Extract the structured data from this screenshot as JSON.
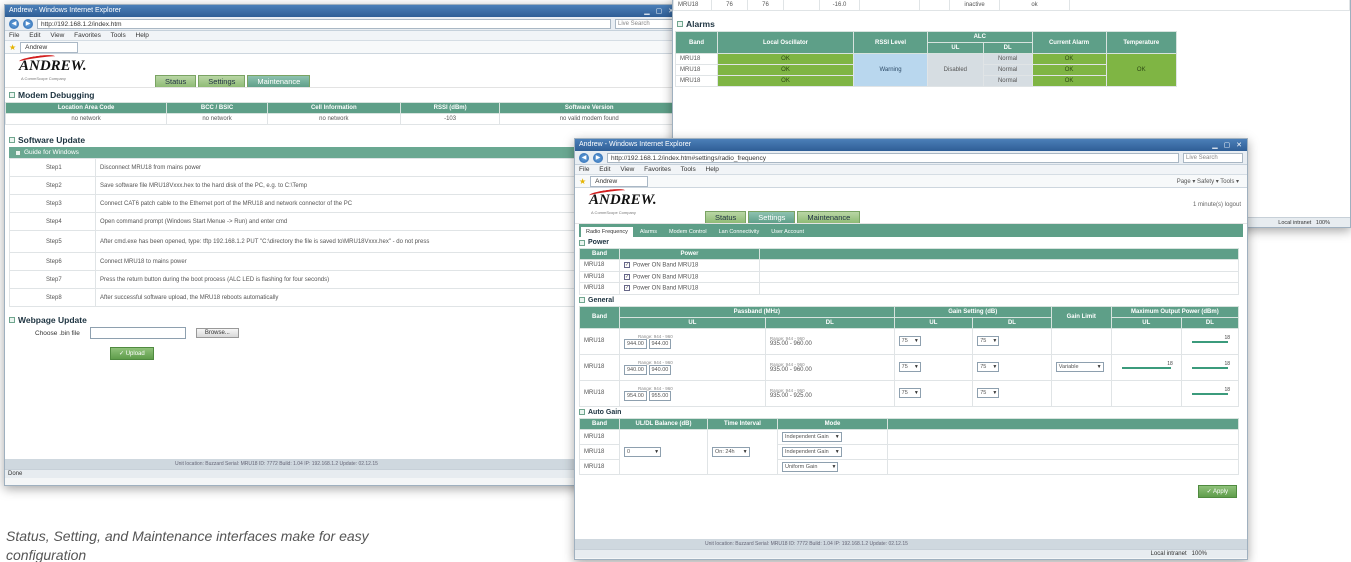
{
  "caption": "Status, Setting, and Maintenance interfaces make for easy configuration",
  "icons": [
    "back-arrow-icon",
    "forward-arrow-icon",
    "star-icon",
    "checkbox-icon",
    "dropdown-chevron-icon",
    "close-icon"
  ],
  "colors": {
    "accent_teal": "#5e9f88",
    "tab_green": "#8fbb75",
    "status_green": "#7fb544",
    "brand_red": "#d21f1f"
  },
  "win1": {
    "title": "Andrew - Windows Internet Explorer",
    "url": "http://192.168.1.2/index.htm",
    "menu": [
      "File",
      "Edit",
      "View",
      "Favorites",
      "Tools",
      "Help"
    ],
    "tab": "Andrew",
    "logo": "ANDREW.",
    "logo_sub": "A CommScope Company",
    "tabs": [
      "Status",
      "Settings",
      "Maintenance"
    ],
    "modem": {
      "title": "Modem Debugging",
      "headers": [
        "Location Area Code",
        "BCC / BSIC",
        "Cell Information",
        "RSSI (dBm)",
        "Software Version"
      ],
      "row": [
        "no network",
        "no network",
        "no network",
        "-103",
        "no valid modem found"
      ]
    },
    "software": {
      "title": "Software Update",
      "subtitle": "Guide for Windows",
      "steps": [
        {
          "step": "Step1",
          "text": "Disconnect MRU18 from mains power"
        },
        {
          "step": "Step2",
          "text": "Save software file MRU18Vxxx.hex to the hard disk of the PC, e.g. to C:\\Temp"
        },
        {
          "step": "Step3",
          "text": "Connect CAT6 patch cable to the Ethernet port of the MRU18 and network connector of the PC"
        },
        {
          "step": "Step4",
          "text": "Open command prompt (Windows Start Menue -> Run) and enter cmd"
        },
        {
          "step": "Step5",
          "text": "After cmd.exe has been opened, type: tftp 192.168.1.2 PUT \"C:\\directory the file is saved to\\MRU18Vxxx.hex\" - do not press"
        },
        {
          "step": "Step6",
          "text": "Connect MRU18 to mains power"
        },
        {
          "step": "Step7",
          "text": "Press the return button during the boot process (ALC LED is flashing for four seconds)"
        },
        {
          "step": "Step8",
          "text": "After successful software upload, the MRU18 reboots automatically"
        }
      ]
    },
    "webpage": {
      "title": "Webpage Update",
      "choose_label": "Choose .bin file",
      "browse": "Browse...",
      "upload": "Upload"
    },
    "footer": "Unit location: Buzzard   Serial: MRU18   ID: 7772   Build: 1.04   IP: 192.168.1.2   Update: 02.12.15",
    "status": "Done"
  },
  "win2": {
    "band": "MRU18",
    "row_vals": [
      "76",
      "76",
      "-16.0",
      "inactive",
      "ok"
    ],
    "alarms_title": "Alarms",
    "alarm_headers": [
      "Band",
      "Local Oscillator",
      "RSSI Level",
      "ALC",
      "Current Alarm",
      "Temperature"
    ],
    "alc_sub": [
      "UL",
      "DL"
    ],
    "alarm_rows": [
      {
        "band": "MRU18",
        "lo": "OK",
        "alc_dl": "Normal",
        "current": "OK"
      },
      {
        "band": "MRU18",
        "lo": "OK",
        "alc_dl": "Normal",
        "current": "OK"
      },
      {
        "band": "MRU18",
        "lo": "OK",
        "alc_dl": "Normal",
        "current": "OK"
      }
    ],
    "rssi": "Warning",
    "alc_ul": "Disabled",
    "temperature": "OK",
    "footer_tail": "Local intranet",
    "zoom": "100%"
  },
  "win3": {
    "title": "Andrew - Windows Internet Explorer",
    "url": "http://192.168.1.2/index.htm#settings/radio_frequency",
    "menu": [
      "File",
      "Edit",
      "View",
      "Favorites",
      "Tools",
      "Help"
    ],
    "tab": "Andrew",
    "logo": "ANDREW.",
    "logo_sub": "A CommScope Company",
    "tabs": [
      "Status",
      "Settings",
      "Maintenance"
    ],
    "head_right": "1 minute(s) logout",
    "sub_tabs": [
      "Radio Frequency",
      "Alarms",
      "Modem Control",
      "Lan Connectivity",
      "User Account"
    ],
    "power": {
      "title": "Power",
      "headers": [
        "Band",
        "Power"
      ],
      "rows": [
        "Power ON Band MRU18",
        "Power ON Band MRU18",
        "Power ON Band MRU18"
      ],
      "band": "MRU18"
    },
    "general": {
      "title": "General",
      "headers": [
        "Band",
        "Passband (MHz)",
        "Gain Setting (dB)",
        "Gain Limit",
        "Maximum Output Power (dBm)"
      ],
      "sub": [
        "UL",
        "DL"
      ],
      "rows": [
        {
          "range": "Range: 944 - 960",
          "a": "944.00",
          "b": "944.00",
          "r2": "Range: 944 - 960",
          "rng": "935.00 - 960.00",
          "g1": "75",
          "g2": "75",
          "limit": "",
          "p1": "18",
          "p2": "18"
        },
        {
          "range": "Range: 944 - 960",
          "a": "940.00",
          "b": "940.00",
          "r2": "Range: 944 - 960",
          "rng": "935.00 - 960.00",
          "g1": "75",
          "g2": "75",
          "limit": "Variable",
          "p1": "18",
          "p2": "18"
        },
        {
          "range": "Range: 944 - 960",
          "a": "954.00",
          "b": "955.00",
          "r2": "Range: 944 - 960",
          "rng": "935.00 - 925.00",
          "g1": "75",
          "g2": "75",
          "limit": "",
          "p1": "18",
          "p2": "18"
        }
      ],
      "band": "MRU18"
    },
    "autogain": {
      "title": "Auto Gain",
      "headers": [
        "Band",
        "UL/DL Balance (dB)",
        "Time Interval",
        "Mode"
      ],
      "balance": "0",
      "interval": "On: 24h",
      "modes": [
        "Independent Gain",
        "Independent Gain",
        "Uniform Gain"
      ],
      "band": "MRU18"
    },
    "apply": "Apply",
    "footer": "Unit location: Buzzard   Serial: MRU18   ID: 7772   Build: 1.04   IP: 192.168.1.2   Update: 02.12.15",
    "status_zoom": "100%",
    "status_zone": "Local intranet",
    "cmd_bar": "Page ▾  Safety ▾  Tools ▾"
  }
}
